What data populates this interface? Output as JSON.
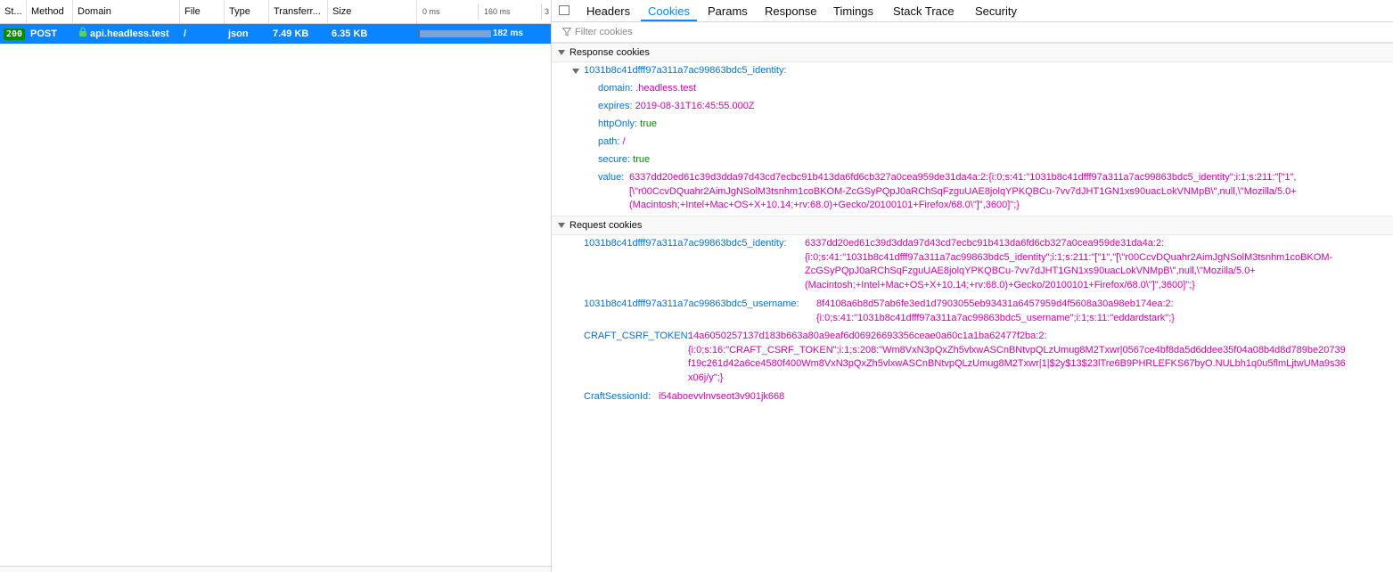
{
  "columns": {
    "status": "St...",
    "method": "Method",
    "domain": "Domain",
    "file": "File",
    "type": "Type",
    "transferred": "Transferr...",
    "size": "Size",
    "tick0": "0 ms",
    "tick1": "160 ms",
    "tick2": "3"
  },
  "request": {
    "status": "200",
    "method": "POST",
    "domain": "api.headless.test",
    "file": "/",
    "type": "json",
    "transferred": "7.49 KB",
    "size": "6.35 KB",
    "duration": "182 ms"
  },
  "tabs": [
    "Headers",
    "Cookies",
    "Params",
    "Response",
    "Timings",
    "Stack Trace",
    "Security"
  ],
  "active_tab": "Cookies",
  "filter": {
    "placeholder": "Filter cookies"
  },
  "response_section": {
    "label": "Response cookies",
    "cookie_name": "1031b8c41dfff97a311a7ac99863bdc5_identity:",
    "props": [
      {
        "key": "domain:",
        "value": ".headless.test"
      },
      {
        "key": "expires:",
        "value": "2019-08-31T16:45:55.000Z"
      },
      {
        "key": "httpOnly:",
        "value": "true"
      },
      {
        "key": "path:",
        "value": "/"
      },
      {
        "key": "secure:",
        "value": "true"
      }
    ],
    "value_key": "value:",
    "value_lines": [
      "6337dd20ed61c39d3dda97d43cd7ecbc91b413da6fd6cb327a0cea959de31da4a:2:{i:0;s:41:\"1031b8c41dfff97a311a7ac99863bdc5_identity\";i:1;s:211:\"[\"1\",",
      "[\\\"r00CcvDQuahr2AimJgNSolM3tsnhm1coBKOM-ZcGSyPQpJ0aRChSqFzguUAE8jolqYPKQBCu-7vv7dJHT1GN1xs90uacLokVNMpB\\\",null,\\\"Mozilla/5.0+",
      "(Macintosh;+Intel+Mac+OS+X+10.14;+rv:68.0)+Gecko/20100101+Firefox/68.0\\\"]\",3600]\";}"
    ]
  },
  "request_section": {
    "label": "Request cookies",
    "cookies": [
      {
        "name": "1031b8c41dfff97a311a7ac99863bdc5_identity:",
        "lines": [
          "6337dd20ed61c39d3dda97d43cd7ecbc91b413da6fd6cb327a0cea959de31da4a:2:",
          "{i:0;s:41:\"1031b8c41dfff97a311a7ac99863bdc5_identity\";i:1;s:211:\"[\"1\",\"[\\\"r00CcvDQuahr2AimJgNSolM3tsnhm1coBKOM-",
          "ZcGSyPQpJ0aRChSqFzguUAE8jolqYPKQBCu-7vv7dJHT1GN1xs90uacLokVNMpB\\\",null,\\\"Mozilla/5.0+",
          "(Macintosh;+Intel+Mac+OS+X+10.14;+rv:68.0)+Gecko/20100101+Firefox/68.0\\\"]\",3600]\";}"
        ]
      },
      {
        "name": "1031b8c41dfff97a311a7ac99863bdc5_username:",
        "lines": [
          "8f4108a6b8d57ab6fe3ed1d7903055eb93431a6457959d4f5608a30a98eb174ea:2:",
          "{i:0;s:41:\"1031b8c41dfff97a311a7ac99863bdc5_username\";i:1;s:11:\"eddardstark\";}"
        ]
      },
      {
        "name": "CRAFT_CSRF_TOKEN:",
        "lines": [
          "14a6050257137d183b663a80a9eaf6d06926693356ceae0a60c1a1ba62477f2ba:2:",
          "{i:0;s:16:\"CRAFT_CSRF_TOKEN\";i:1;s:208:\"Wm8VxN3pQxZh5vlxwASCnBNtvpQLzUmug8M2Txwr|0567ce4bf8da5d6ddee35f04a08b4d8d789be20739",
          "f19c261d42a6ce4580f400Wm8VxN3pQxZh5vlxwASCnBNtvpQLzUmug8M2Txwr|1|$2y$13$23lTre6B9PHRLEFKS67byO.NULbh1q0u5flmLjtwUMa9s36",
          "x06j/y\";}"
        ]
      },
      {
        "name": "CraftSessionId:",
        "lines": [
          "i54aboevvlnvseot3v901jk668"
        ]
      }
    ]
  },
  "colors": {
    "accent": "#0a84ff",
    "status_ok": "#058b00",
    "cookie_key": "#0074e8",
    "cookie_value": "#dd00a9",
    "boolean": "#058b00"
  }
}
